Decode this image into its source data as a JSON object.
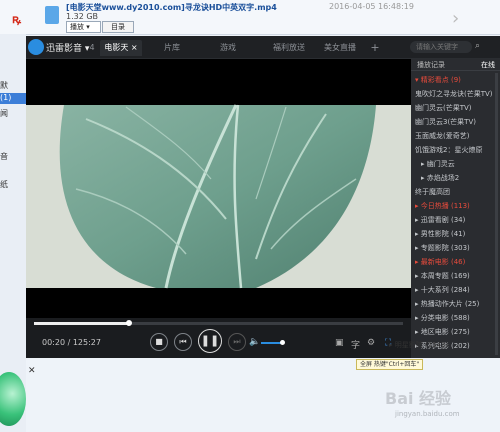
{
  "background_window": {
    "file_name": "[电影天堂www.dy2010.com]寻龙诀HD中英双字.mp4",
    "file_size": "1.32 GB",
    "date": "2016-04-05 16:48:19",
    "play_label": "播放",
    "dir_label": "目录",
    "side_items": [
      "默",
      "(1)",
      "闻",
      "音",
      "纸"
    ]
  },
  "player": {
    "logo_text": "迅雷影音",
    "tabs": [
      "4",
      "电影天",
      "片库",
      "游戏",
      "福利放送",
      "美女直播"
    ],
    "add_tab": "+",
    "search_placeholder": "请输入关键字",
    "time_current": "00:20",
    "time_total": "125:27",
    "tooltip": "全屏 热键\"Ctrl+回车\"",
    "subtitle_icon": "字"
  },
  "playlist": {
    "tabs": [
      "播放记录",
      "在线"
    ],
    "items": [
      {
        "label": "▾ 精彩看点 (9)",
        "style": "red"
      },
      {
        "label": "鬼吹灯之寻龙诀(芒果TV)",
        "style": ""
      },
      {
        "label": "幽门灵云(芒果TV)",
        "style": ""
      },
      {
        "label": "幽门灵云3(芒果TV)",
        "style": ""
      },
      {
        "label": "玉面威龙(爱奇艺)",
        "style": ""
      },
      {
        "label": "饥饿游戏2：星火燎原",
        "style": ""
      },
      {
        "label": "▸ 幽门灵云",
        "style": "sub"
      },
      {
        "label": "▸ 赤焰战场2",
        "style": "sub"
      },
      {
        "label": "终于魔高团",
        "style": ""
      },
      {
        "label": "▸ 今日热播 (113)",
        "style": "red"
      },
      {
        "label": "▸ 迅雷看剧 (34)",
        "style": ""
      },
      {
        "label": "▸ 男性影院 (41)",
        "style": ""
      },
      {
        "label": "▸ 专题影院 (303)",
        "style": ""
      },
      {
        "label": "▸ 最新电影 (46)",
        "style": "red"
      },
      {
        "label": "▸ 本周专题 (169)",
        "style": ""
      },
      {
        "label": "▸ 十大系列 (284)",
        "style": ""
      },
      {
        "label": "▸ 热播动作大片 (25)",
        "style": ""
      },
      {
        "label": "▸ 分类电影 (588)",
        "style": ""
      },
      {
        "label": "▸ 地区电影 (275)",
        "style": ""
      },
      {
        "label": "▸ 系列电影 (202)",
        "style": ""
      },
      {
        "label": "▸ 明星影院 (1543)",
        "style": ""
      }
    ]
  },
  "watermark": {
    "main": "Bai 经验",
    "sub": "jingyan.baidu.com"
  },
  "colors": {
    "accent": "#2a8de0",
    "highlight": "#e84b3c"
  }
}
